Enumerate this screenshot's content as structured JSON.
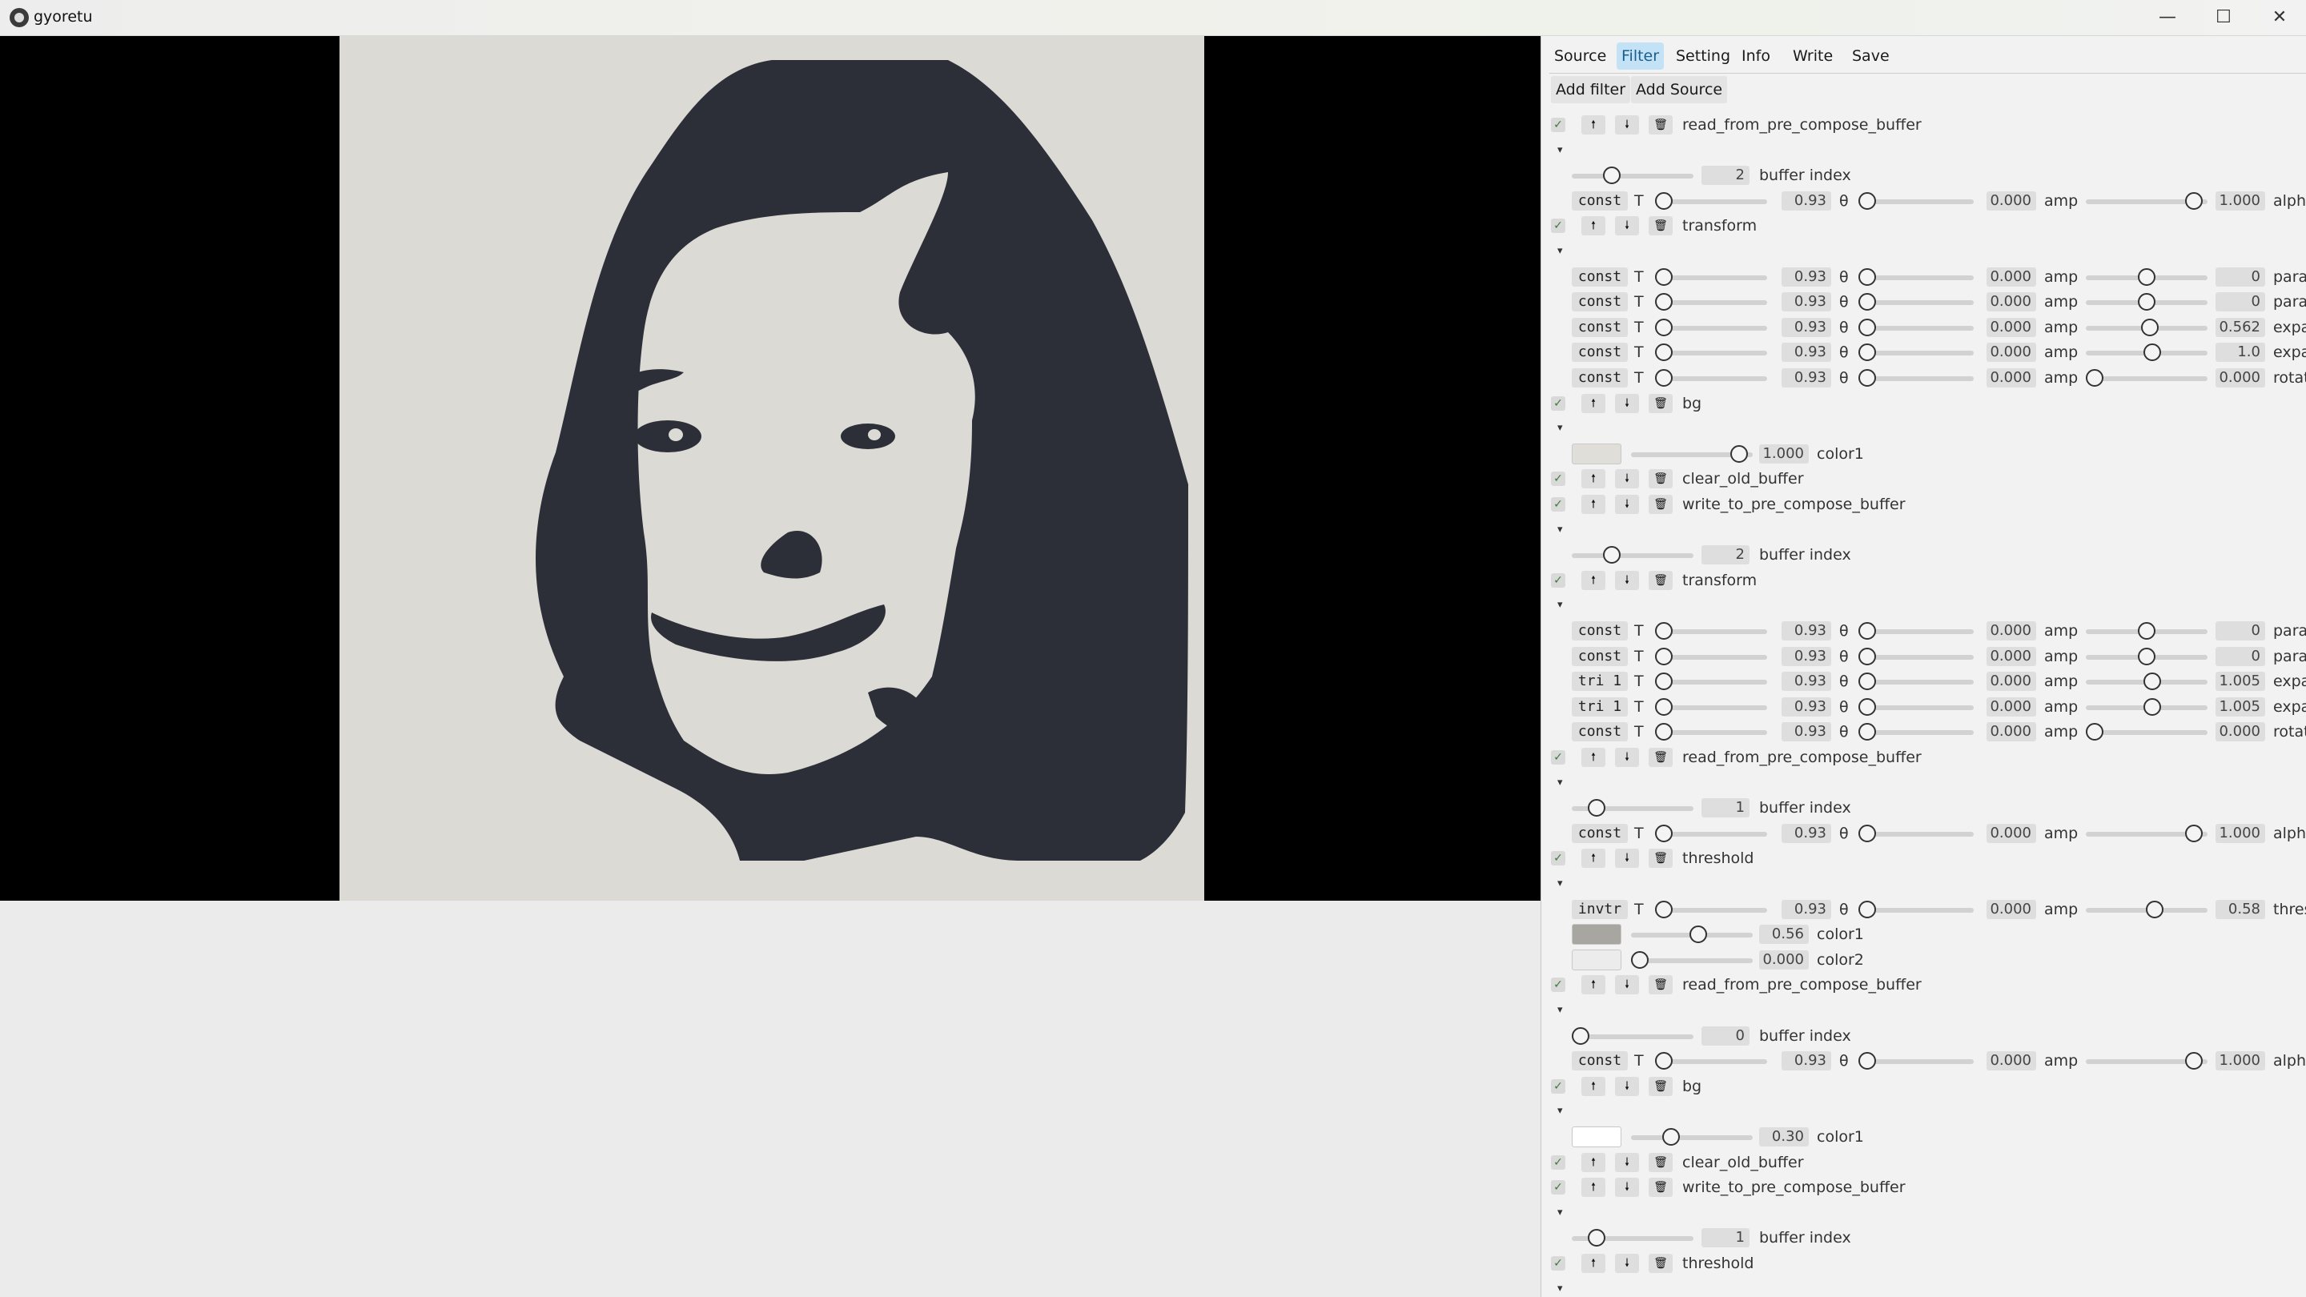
{
  "window": {
    "title": "gyoretu",
    "minimize": "—",
    "maximize": "☐",
    "close": "✕"
  },
  "tabs": [
    "Source",
    "Filter",
    "Setting",
    "Info",
    "Write",
    "Save"
  ],
  "active_tab": "Filter",
  "buttons": {
    "add_filter": "Add filter",
    "add_source": "Add Source"
  },
  "glyphs": {
    "check": "✓",
    "up": "🠕",
    "down": "🠗",
    "trash": "🗑",
    "collapse": "▾",
    "T": "T",
    "theta": "θ",
    "amp": "amp"
  },
  "colors": {
    "canvas_bg": "#dcdad5",
    "silhouette": "#2d2f38",
    "accent_tab": "#c3e2f6"
  },
  "filters": [
    {
      "name": "read_from_pre_compose_buffer",
      "params": [
        {
          "kind": "index",
          "value": "2",
          "label": "buffer index",
          "level": 0.3
        },
        {
          "kind": "wave",
          "mode": "const",
          "T": "0.93",
          "theta": "0.000",
          "value": "1.000",
          "label": "alph",
          "level": 0.95
        }
      ]
    },
    {
      "name": "transform",
      "params": [
        {
          "kind": "wave",
          "mode": "const",
          "T": "0.93",
          "theta": "0.000",
          "value": "0",
          "label": "para",
          "level": 0.5
        },
        {
          "kind": "wave",
          "mode": "const",
          "T": "0.93",
          "theta": "0.000",
          "value": "0",
          "label": "para",
          "level": 0.5
        },
        {
          "kind": "wave",
          "mode": "const",
          "T": "0.93",
          "theta": "0.000",
          "value": "0.562",
          "label": "expa",
          "level": 0.53
        },
        {
          "kind": "wave",
          "mode": "const",
          "T": "0.93",
          "theta": "0.000",
          "value": "1.0",
          "label": "expa",
          "level": 0.55
        },
        {
          "kind": "wave",
          "mode": "const",
          "T": "0.93",
          "theta": "0.000",
          "value": "0.000",
          "label": "rotat",
          "level": 0.0
        }
      ]
    },
    {
      "name": "bg",
      "params": [
        {
          "kind": "color",
          "swatch": "#e0ded9",
          "value": "1.000",
          "label": "color1",
          "level": 0.95
        }
      ]
    },
    {
      "name": "clear_old_buffer",
      "params": []
    },
    {
      "name": "write_to_pre_compose_buffer",
      "params": [
        {
          "kind": "index",
          "value": "2",
          "label": "buffer index",
          "level": 0.3
        }
      ]
    },
    {
      "name": "transform",
      "params": [
        {
          "kind": "wave",
          "mode": "const",
          "T": "0.93",
          "theta": "0.000",
          "value": "0",
          "label": "para",
          "level": 0.5
        },
        {
          "kind": "wave",
          "mode": "const",
          "T": "0.93",
          "theta": "0.000",
          "value": "0",
          "label": "para",
          "level": 0.5
        },
        {
          "kind": "wave",
          "mode": "tri 1",
          "T": "0.93",
          "theta": "0.000",
          "value": "1.005",
          "label": "expa",
          "level": 0.55
        },
        {
          "kind": "wave",
          "mode": "tri 1",
          "T": "0.93",
          "theta": "0.000",
          "value": "1.005",
          "label": "expa",
          "level": 0.55
        },
        {
          "kind": "wave",
          "mode": "const",
          "T": "0.93",
          "theta": "0.000",
          "value": "0.000",
          "label": "rotat",
          "level": 0.0
        }
      ]
    },
    {
      "name": "read_from_pre_compose_buffer",
      "params": [
        {
          "kind": "index",
          "value": "1",
          "label": "buffer index",
          "level": 0.15
        },
        {
          "kind": "wave",
          "mode": "const",
          "T": "0.93",
          "theta": "0.000",
          "value": "1.000",
          "label": "alph",
          "level": 0.95
        }
      ]
    },
    {
      "name": "threshold",
      "params": [
        {
          "kind": "wave",
          "mode": "invtr",
          "T": "0.93",
          "theta": "0.000",
          "value": "0.58",
          "label": "thres",
          "level": 0.58
        },
        {
          "kind": "color",
          "swatch": "#a7a6a1",
          "value": "0.56",
          "label": "color1",
          "level": 0.56
        },
        {
          "kind": "color",
          "swatch": "#ececec",
          "value": "0.000",
          "label": "color2",
          "level": 0.0
        }
      ]
    },
    {
      "name": "read_from_pre_compose_buffer",
      "params": [
        {
          "kind": "index",
          "value": "0",
          "label": "buffer index",
          "level": 0.0
        },
        {
          "kind": "wave",
          "mode": "const",
          "T": "0.93",
          "theta": "0.000",
          "value": "1.000",
          "label": "alph",
          "level": 0.95
        }
      ]
    },
    {
      "name": "bg",
      "params": [
        {
          "kind": "color",
          "swatch": "#ffffff",
          "value": "0.30",
          "label": "color1",
          "level": 0.3
        }
      ]
    },
    {
      "name": "clear_old_buffer",
      "params": []
    },
    {
      "name": "write_to_pre_compose_buffer",
      "params": [
        {
          "kind": "index",
          "value": "1",
          "label": "buffer index",
          "level": 0.15
        }
      ]
    },
    {
      "name": "threshold",
      "params": []
    }
  ]
}
